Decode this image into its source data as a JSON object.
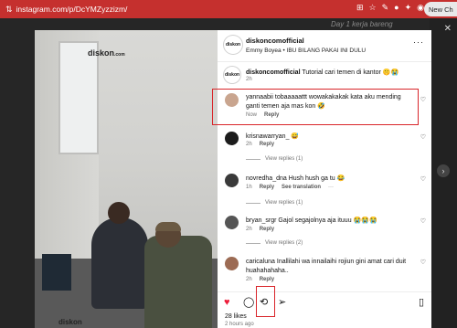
{
  "browser": {
    "url": "instagram.com/p/DcYMZyzzizm/",
    "new_chat_label": "New Ch"
  },
  "background": {
    "hint_text": "Day 1 kerja bareng"
  },
  "post": {
    "author": "diskoncomofficial",
    "subtitle": "Emmy Boyea • IBU BILANG PAKAI INI DULU",
    "more_label": "···",
    "caption_author": "diskoncomofficial",
    "caption_text": "Tutorial cari temen di kantor 🤫😭",
    "caption_time": "2h",
    "photo_logo": "diskon",
    "photo_logo_sub": ".com",
    "photo_logo_bottom": "diskon"
  },
  "comments": [
    {
      "user": "yannaabii",
      "text": "tobaaaaattt wowakakakak kata aku mending ganti temen aja mas kon 🤣",
      "time": "Now",
      "reply_label": "Reply",
      "translate_label": "",
      "view_replies": ""
    },
    {
      "user": "krisnawarryan_",
      "text": "😅",
      "time": "2h",
      "reply_label": "Reply",
      "translate_label": "",
      "view_replies": "View replies (1)"
    },
    {
      "user": "novredha_dna",
      "text": "Hush hush ga tu 😂",
      "time": "1h",
      "reply_label": "Reply",
      "translate_label": "See translation",
      "view_replies": "View replies (1)"
    },
    {
      "user": "bryan_srgr",
      "text": "Gajol segajolnya aja ituuu 😭😭😭",
      "time": "2h",
      "reply_label": "Reply",
      "translate_label": "",
      "view_replies": "View replies (2)"
    },
    {
      "user": "caricaluna",
      "text": "Inallilahi wa innailaihi rojiun gini amat cari duit huahahahaha..",
      "time": "2h",
      "reply_label": "Reply",
      "translate_label": "",
      "view_replies": ""
    }
  ],
  "actions": {
    "likes": "28 likes",
    "time_ago": "2 hours ago"
  },
  "icons": {
    "heart": "heart-filled-icon",
    "comment": "comment-icon",
    "repost": "repost-icon",
    "share": "share-icon",
    "save": "bookmark-icon"
  },
  "colors": {
    "browser_bar": "#c5302e",
    "highlight": "#d9252a",
    "like_red": "#ed1c3a"
  }
}
